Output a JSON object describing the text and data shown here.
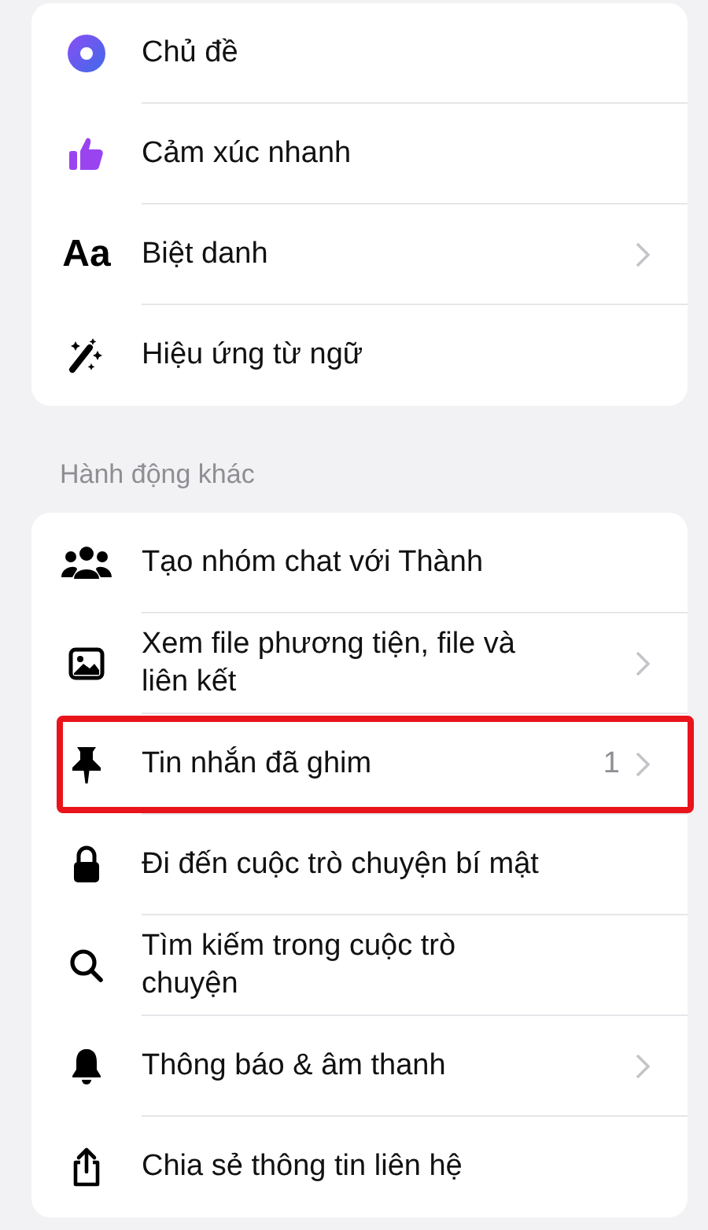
{
  "sections": [
    {
      "items": [
        {
          "kind": "theme",
          "label": "Chủ đề",
          "chevron": false,
          "highlighted": false
        },
        {
          "kind": "reaction",
          "label": "Cảm xúc nhanh",
          "chevron": false,
          "highlighted": false
        },
        {
          "kind": "nickname",
          "glyph": "Aa",
          "label": "Biệt danh",
          "chevron": true,
          "highlighted": false
        },
        {
          "kind": "effects",
          "label": "Hiệu ứng từ ngữ",
          "chevron": false,
          "highlighted": false
        }
      ]
    },
    {
      "header": "Hành động khác",
      "items": [
        {
          "kind": "group",
          "label": "Tạo nhóm chat với Thành",
          "chevron": false,
          "highlighted": false
        },
        {
          "kind": "media",
          "label": "Xem file phương tiện, file và liên kết",
          "chevron": true,
          "highlighted": false
        },
        {
          "kind": "pin",
          "label": "Tin nhắn đã ghim",
          "count": "1",
          "chevron": true,
          "highlighted": true
        },
        {
          "kind": "lock",
          "label": "Đi đến cuộc trò chuyện bí mật",
          "chevron": false,
          "highlighted": false
        },
        {
          "kind": "search",
          "label": "Tìm kiếm trong cuộc trò chuyện",
          "chevron": false,
          "highlighted": false
        },
        {
          "kind": "bell",
          "label": "Thông báo & âm thanh",
          "chevron": true,
          "highlighted": false
        },
        {
          "kind": "share",
          "label": "Chia sẻ thông tin liên hệ",
          "chevron": false,
          "highlighted": false
        }
      ]
    }
  ]
}
